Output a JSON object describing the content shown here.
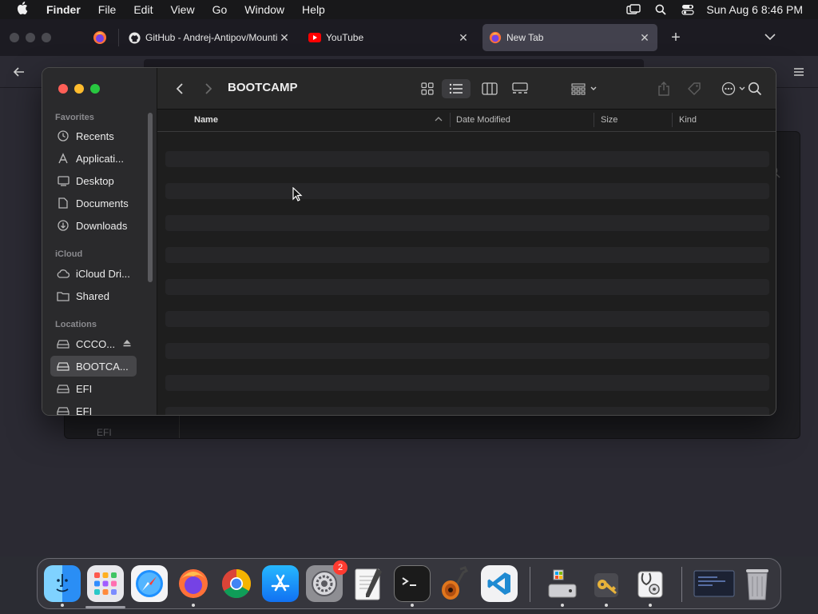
{
  "menubar": {
    "apple_icon": "apple-logo-icon",
    "app_name": "Finder",
    "menus": [
      "File",
      "Edit",
      "View",
      "Go",
      "Window",
      "Help"
    ],
    "status_icons": [
      "screen-mirroring-icon",
      "search-icon",
      "control-center-icon"
    ],
    "clock": "Sun Aug 6  8:46 PM"
  },
  "browser": {
    "tabs": [
      {
        "title": "GitHub - Andrej-Antipov/Mounti",
        "icon": "github-icon"
      },
      {
        "title": "YouTube",
        "icon": "youtube-icon"
      },
      {
        "title": "New Tab",
        "icon": "firefox-icon",
        "active": true
      }
    ],
    "background_label": "EFI",
    "colors": {
      "tabbar": "#1c1b22",
      "active_tab": "#42414d",
      "content": "#2b2a33"
    }
  },
  "finder": {
    "title": "BOOTCAMP",
    "sidebar": {
      "sections": [
        {
          "header": "Favorites",
          "items": [
            {
              "label": "Recents",
              "icon": "clock-icon"
            },
            {
              "label": "Applicati...",
              "icon": "applications-icon"
            },
            {
              "label": "Desktop",
              "icon": "desktop-icon"
            },
            {
              "label": "Documents",
              "icon": "document-icon"
            },
            {
              "label": "Downloads",
              "icon": "download-icon"
            }
          ]
        },
        {
          "header": "iCloud",
          "items": [
            {
              "label": "iCloud Dri...",
              "icon": "cloud-icon"
            },
            {
              "label": "Shared",
              "icon": "shared-folder-icon"
            }
          ]
        },
        {
          "header": "Locations",
          "items": [
            {
              "label": "CCCO...",
              "icon": "drive-icon",
              "eject": true
            },
            {
              "label": "BOOTCA...",
              "icon": "drive-icon",
              "selected": true
            },
            {
              "label": "EFI",
              "icon": "drive-icon"
            },
            {
              "label": "EFI",
              "icon": "drive-icon"
            }
          ]
        }
      ]
    },
    "toolbar_icons": [
      "back-icon",
      "forward-icon",
      "icon-view-icon",
      "list-view-icon",
      "column-view-icon",
      "gallery-view-icon",
      "group-icon",
      "share-icon",
      "tag-icon",
      "more-icon",
      "search-icon"
    ],
    "columns": [
      "Name",
      "Date Modified",
      "Size",
      "Kind"
    ],
    "sort_column": "Name",
    "sort_direction": "ascending",
    "colors": {
      "close": "#fe5f57",
      "minimize": "#febc2e",
      "zoom": "#28c840"
    }
  },
  "dock": {
    "apps": [
      {
        "name": "Finder",
        "icon": "finder-icon",
        "running": true
      },
      {
        "name": "Launchpad",
        "icon": "launchpad-icon"
      },
      {
        "name": "Safari",
        "icon": "safari-icon"
      },
      {
        "name": "Firefox",
        "icon": "firefox-icon",
        "running": true
      },
      {
        "name": "Google Chrome",
        "icon": "chrome-icon"
      },
      {
        "name": "App Store",
        "icon": "app-store-icon"
      },
      {
        "name": "System Settings",
        "icon": "settings-icon",
        "badge": "2"
      },
      {
        "name": "TextEdit",
        "icon": "textedit-icon"
      },
      {
        "name": "Terminal",
        "icon": "terminal-icon",
        "running": true
      },
      {
        "name": "GarageBand",
        "icon": "garageband-icon"
      },
      {
        "name": "Visual Studio Code",
        "icon": "vscode-icon"
      },
      {
        "name": "Boot Camp Assistant",
        "icon": "bootcamp-icon",
        "running": true
      },
      {
        "name": "Keychain Access",
        "icon": "keychain-icon",
        "running": true
      },
      {
        "name": "Disk Utility",
        "icon": "disk-utility-icon",
        "running": true
      },
      {
        "name": "Screen Thumbnail",
        "icon": "window-thumbnail-icon"
      },
      {
        "name": "Trash",
        "icon": "trash-icon"
      }
    ]
  }
}
